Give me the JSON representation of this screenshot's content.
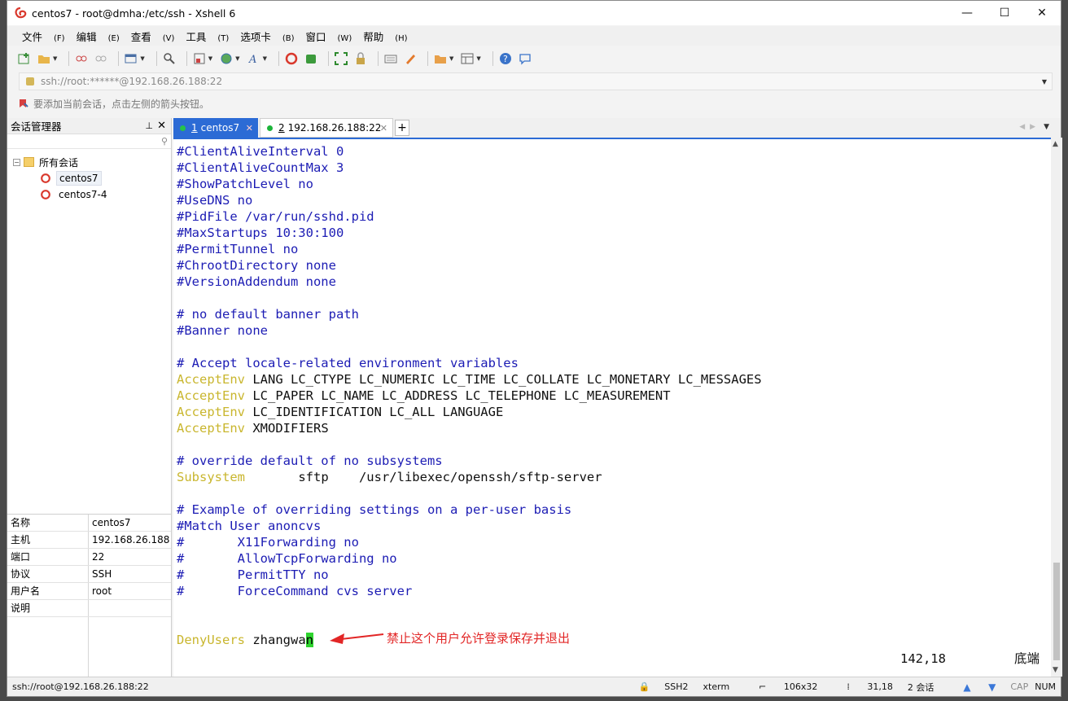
{
  "window": {
    "title": "centos7 - root@dmha:/etc/ssh - Xshell 6",
    "controls": [
      "—",
      "☐",
      "✕"
    ]
  },
  "menu": [
    {
      "label": "文件",
      "key": "(F)"
    },
    {
      "label": "编辑",
      "key": "(E)"
    },
    {
      "label": "查看",
      "key": "(V)"
    },
    {
      "label": "工具",
      "key": "(T)"
    },
    {
      "label": "选项卡",
      "key": "(B)"
    },
    {
      "label": "窗口",
      "key": "(W)"
    },
    {
      "label": "帮助",
      "key": "(H)"
    }
  ],
  "address": {
    "value": "ssh://root:******@192.168.26.188:22"
  },
  "hint": "要添加当前会话，点击左侧的箭头按钮。",
  "sidebar": {
    "title": "会话管理器",
    "tree": {
      "root": "所有会话",
      "items": [
        "centos7",
        "centos7-4"
      ]
    },
    "props": [
      {
        "k": "名称",
        "v": "centos7"
      },
      {
        "k": "主机",
        "v": "192.168.26.188"
      },
      {
        "k": "端口",
        "v": "22"
      },
      {
        "k": "协议",
        "v": "SSH"
      },
      {
        "k": "用户名",
        "v": "root"
      },
      {
        "k": "说明",
        "v": ""
      }
    ]
  },
  "tabs": [
    {
      "num": "1",
      "label": "centos7"
    },
    {
      "num": "2",
      "label": "192.168.26.188:22"
    }
  ],
  "terminal": {
    "lines": [
      {
        "kw": "",
        "text": "#ClientAliveInterval 0",
        "type": "com"
      },
      {
        "kw": "",
        "text": "#ClientAliveCountMax 3",
        "type": "com"
      },
      {
        "kw": "",
        "text": "#ShowPatchLevel no",
        "type": "com"
      },
      {
        "kw": "",
        "text": "#UseDNS no",
        "type": "com"
      },
      {
        "kw": "",
        "text": "#PidFile /var/run/sshd.pid",
        "type": "com"
      },
      {
        "kw": "",
        "text": "#MaxStartups 10:30:100",
        "type": "com"
      },
      {
        "kw": "",
        "text": "#PermitTunnel no",
        "type": "com"
      },
      {
        "kw": "",
        "text": "#ChrootDirectory none",
        "type": "com"
      },
      {
        "kw": "",
        "text": "#VersionAddendum none",
        "type": "com"
      },
      {
        "kw": "",
        "text": "",
        "type": "blank"
      },
      {
        "kw": "",
        "text": "# no default banner path",
        "type": "com"
      },
      {
        "kw": "",
        "text": "#Banner none",
        "type": "com"
      },
      {
        "kw": "",
        "text": "",
        "type": "blank"
      },
      {
        "kw": "",
        "text": "# Accept locale-related environment variables",
        "type": "com"
      },
      {
        "kw": "AcceptEnv",
        "text": " LANG LC_CTYPE LC_NUMERIC LC_TIME LC_COLLATE LC_MONETARY LC_MESSAGES",
        "type": "kw"
      },
      {
        "kw": "AcceptEnv",
        "text": " LC_PAPER LC_NAME LC_ADDRESS LC_TELEPHONE LC_MEASUREMENT",
        "type": "kw"
      },
      {
        "kw": "AcceptEnv",
        "text": " LC_IDENTIFICATION LC_ALL LANGUAGE",
        "type": "kw"
      },
      {
        "kw": "AcceptEnv",
        "text": " XMODIFIERS",
        "type": "kw"
      },
      {
        "kw": "",
        "text": "",
        "type": "blank"
      },
      {
        "kw": "",
        "text": "# override default of no subsystems",
        "type": "com"
      },
      {
        "kw": "Subsystem",
        "text": "       sftp    /usr/libexec/openssh/sftp-server",
        "type": "kw"
      },
      {
        "kw": "",
        "text": "",
        "type": "blank"
      },
      {
        "kw": "",
        "text": "# Example of overriding settings on a per-user basis",
        "type": "com"
      },
      {
        "kw": "",
        "text": "#Match User anoncvs",
        "type": "com"
      },
      {
        "kw": "",
        "text": "#       X11Forwarding no",
        "type": "com"
      },
      {
        "kw": "",
        "text": "#       AllowTcpForwarding no",
        "type": "com"
      },
      {
        "kw": "",
        "text": "#       PermitTTY no",
        "type": "com"
      },
      {
        "kw": "",
        "text": "#       ForceCommand cvs server",
        "type": "com"
      },
      {
        "kw": "",
        "text": "",
        "type": "blank"
      },
      {
        "kw": "",
        "text": "",
        "type": "blank"
      }
    ],
    "deny_kw": "DenyUsers",
    "deny_text": " zhangwa",
    "deny_cursor": "n",
    "position": "142,18",
    "position_label": "底端",
    "annotation": "禁止这个用户允许登录保存并退出"
  },
  "status": {
    "conn": "ssh://root@192.168.26.188:22",
    "proto": "SSH2",
    "term": "xterm",
    "size": "106x32",
    "cursor": "31,18",
    "sessions": "2 会话",
    "cap": "CAP",
    "num": "NUM"
  },
  "colors": {
    "accent": "#2c6bd5",
    "comment": "#1c1cb4",
    "keyword": "#c9b62e",
    "cursor": "#2ed42e",
    "annotation": "#e22626"
  }
}
